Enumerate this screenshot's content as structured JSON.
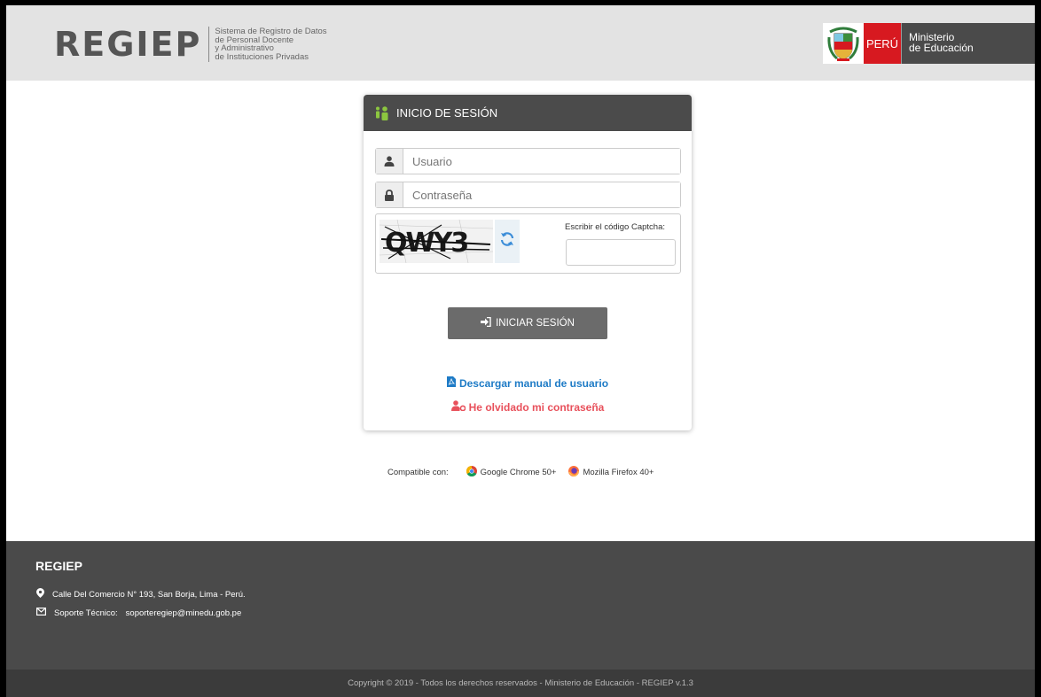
{
  "header": {
    "brand": "REGIEP",
    "subtitle_lines": [
      "Sistema de Registro de Datos",
      "de Personal Docente",
      "y Administrativo",
      "de Instituciones Privadas"
    ],
    "country": "PERÚ",
    "ministry_lines": [
      "Ministerio",
      "de Educación"
    ]
  },
  "login": {
    "title": "INICIO DE SESIÓN",
    "username_placeholder": "Usuario",
    "password_placeholder": "Contraseña",
    "captcha_text": "QWY3",
    "captcha_label": "Escribir el código Captcha:",
    "captcha_value": "",
    "submit_label": "INICIAR SESIÓN",
    "manual_link": "Descargar manual de usuario",
    "forgot_link": "He olvidado mi contraseña"
  },
  "compat": {
    "label": "Compatible con:",
    "chrome": "Google Chrome 50+",
    "firefox": "Mozilla Firefox 40+"
  },
  "footer": {
    "title": "REGIEP",
    "address": "Calle Del Comercio N° 193, San Borja, Lima - Perú.",
    "support_label": "Soporte Técnico:",
    "support_email": "soporteregiep@minedu.gob.pe",
    "copyright": "Copyright © 2019 - Todos los derechos reservados - Ministerio de Educación - REGIEP v.1.3"
  },
  "colors": {
    "header_bg": "#e3e3e3",
    "card_header_bg": "#4b4b4b",
    "button_bg": "#6b6b6b",
    "link_blue": "#1e7bc6",
    "link_red": "#e8505b",
    "footer_bg": "#4a4a4a",
    "peru_red": "#d71920"
  },
  "icons": [
    "user-icon",
    "lock-icon",
    "refresh-icon",
    "sign-in-icon",
    "pdf-icon",
    "user-cog-icon",
    "map-marker-icon",
    "envelope-icon",
    "chrome-icon",
    "firefox-icon",
    "users-icon",
    "peru-shield-icon"
  ]
}
